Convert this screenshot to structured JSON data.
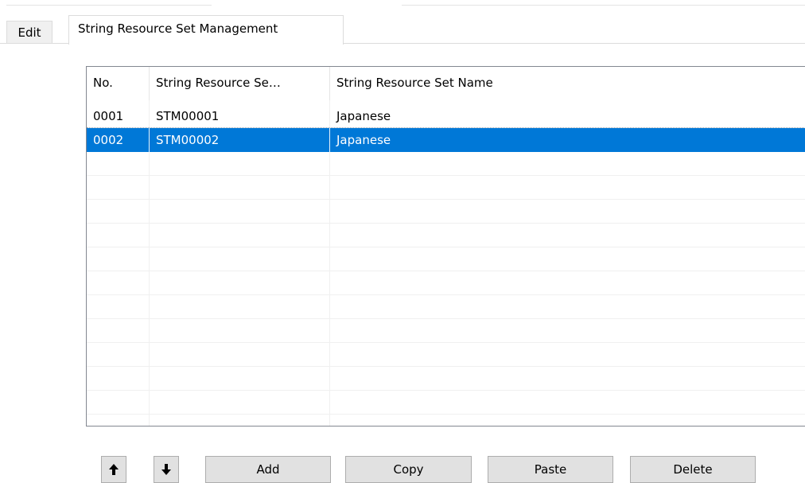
{
  "tabs": [
    {
      "label": "Edit"
    },
    {
      "label": "String Resource Set Management"
    }
  ],
  "list": {
    "columns": [
      "No.",
      "String Resource Se…",
      "String Resource Set Name"
    ],
    "rows": [
      {
        "no": "0001",
        "id": "STM00001",
        "name": "Japanese",
        "selected": false
      },
      {
        "no": "0002",
        "id": "STM00002",
        "name": "Japanese",
        "selected": true
      }
    ],
    "selection_color": "#0078d7"
  },
  "buttons": {
    "up_icon": "up-arrow-icon",
    "down_icon": "down-arrow-icon",
    "add": "Add",
    "copy": "Copy",
    "paste": "Paste",
    "delete": "Delete"
  }
}
